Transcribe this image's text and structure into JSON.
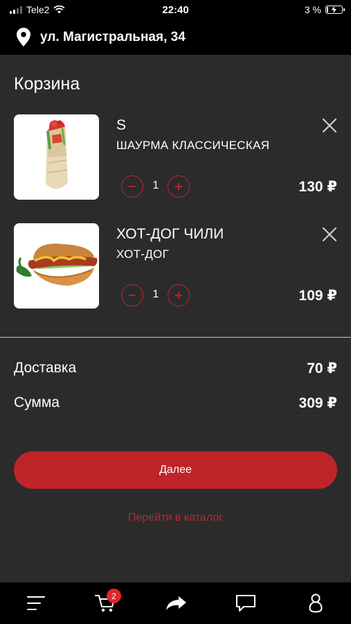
{
  "status_bar": {
    "carrier": "Tele2",
    "time": "22:40",
    "battery": "3 %",
    "battery_level": 0.03
  },
  "header": {
    "address": "ул. Магистральная, 34",
    "location_icon": "location-pin-icon"
  },
  "page": {
    "title": "Корзина"
  },
  "cart": {
    "items": [
      {
        "name": "S",
        "subtitle": "ШАУРМА КЛАССИЧЕСКАЯ",
        "qty": "1",
        "price": "130 ₽",
        "image": "shawarma-image"
      },
      {
        "name": "ХОТ-ДОГ ЧИЛИ",
        "subtitle": "ХОТ-ДОГ",
        "qty": "1",
        "price": "109 ₽",
        "image": "hotdog-image"
      }
    ]
  },
  "summary": {
    "delivery_label": "Доставка",
    "delivery_value": "70 ₽",
    "total_label": "Сумма",
    "total_value": "309 ₽"
  },
  "actions": {
    "next_label": "Далее",
    "catalog_label": "Перейти в каталог"
  },
  "colors": {
    "accent": "#bf2429",
    "background": "#2b2b2b",
    "bar": "#000000"
  },
  "tab_bar": {
    "cart_badge": "2",
    "tabs": [
      "menu-icon",
      "cart-icon",
      "share-icon",
      "chat-icon",
      "profile-icon"
    ]
  }
}
